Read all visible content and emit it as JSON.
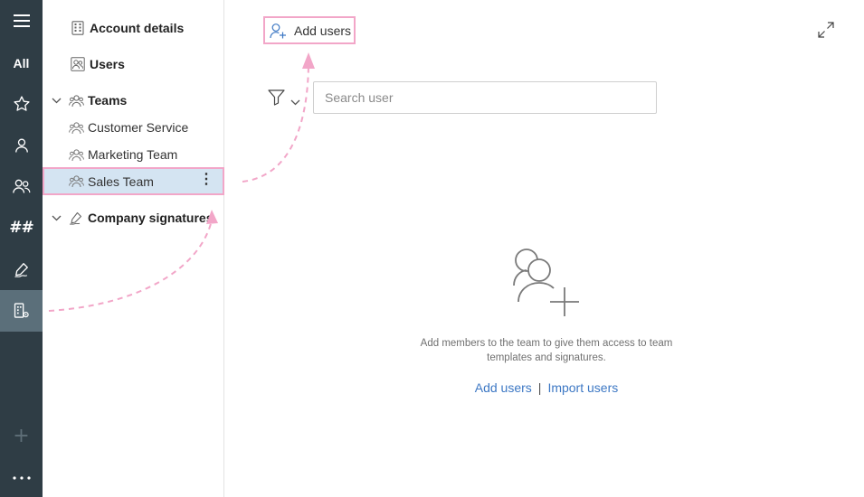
{
  "rail": {
    "items": [
      {
        "icon": "hamburger-menu-icon"
      },
      {
        "label": "All"
      },
      {
        "icon": "star-icon"
      },
      {
        "icon": "user-icon"
      },
      {
        "icon": "users-icon"
      },
      {
        "label": "##"
      },
      {
        "icon": "signature-pen-icon"
      },
      {
        "icon": "building-settings-icon",
        "active": true
      }
    ],
    "add_label": "+",
    "more_label": "⋮"
  },
  "tree": {
    "account_details": "Account details",
    "users": "Users",
    "teams": "Teams",
    "team_items": [
      "Customer Service",
      "Marketing Team",
      "Sales Team"
    ],
    "selected_team": "Sales Team",
    "kebab": "⋮",
    "company_signatures": "Company signatures"
  },
  "main": {
    "add_users_label": "Add users",
    "search_placeholder": "Search user",
    "empty_text": "Add members to the team to give them access to team templates and signatures.",
    "link_add_users": "Add users",
    "link_separator": "|",
    "link_import_users": "Import users"
  },
  "colors": {
    "rail_bg": "#2f3d45",
    "rail_active": "#5b6f7a",
    "selection_bg": "#d4e4f2",
    "highlight_pink": "#f2a6c8",
    "link_blue": "#3d78c4"
  }
}
